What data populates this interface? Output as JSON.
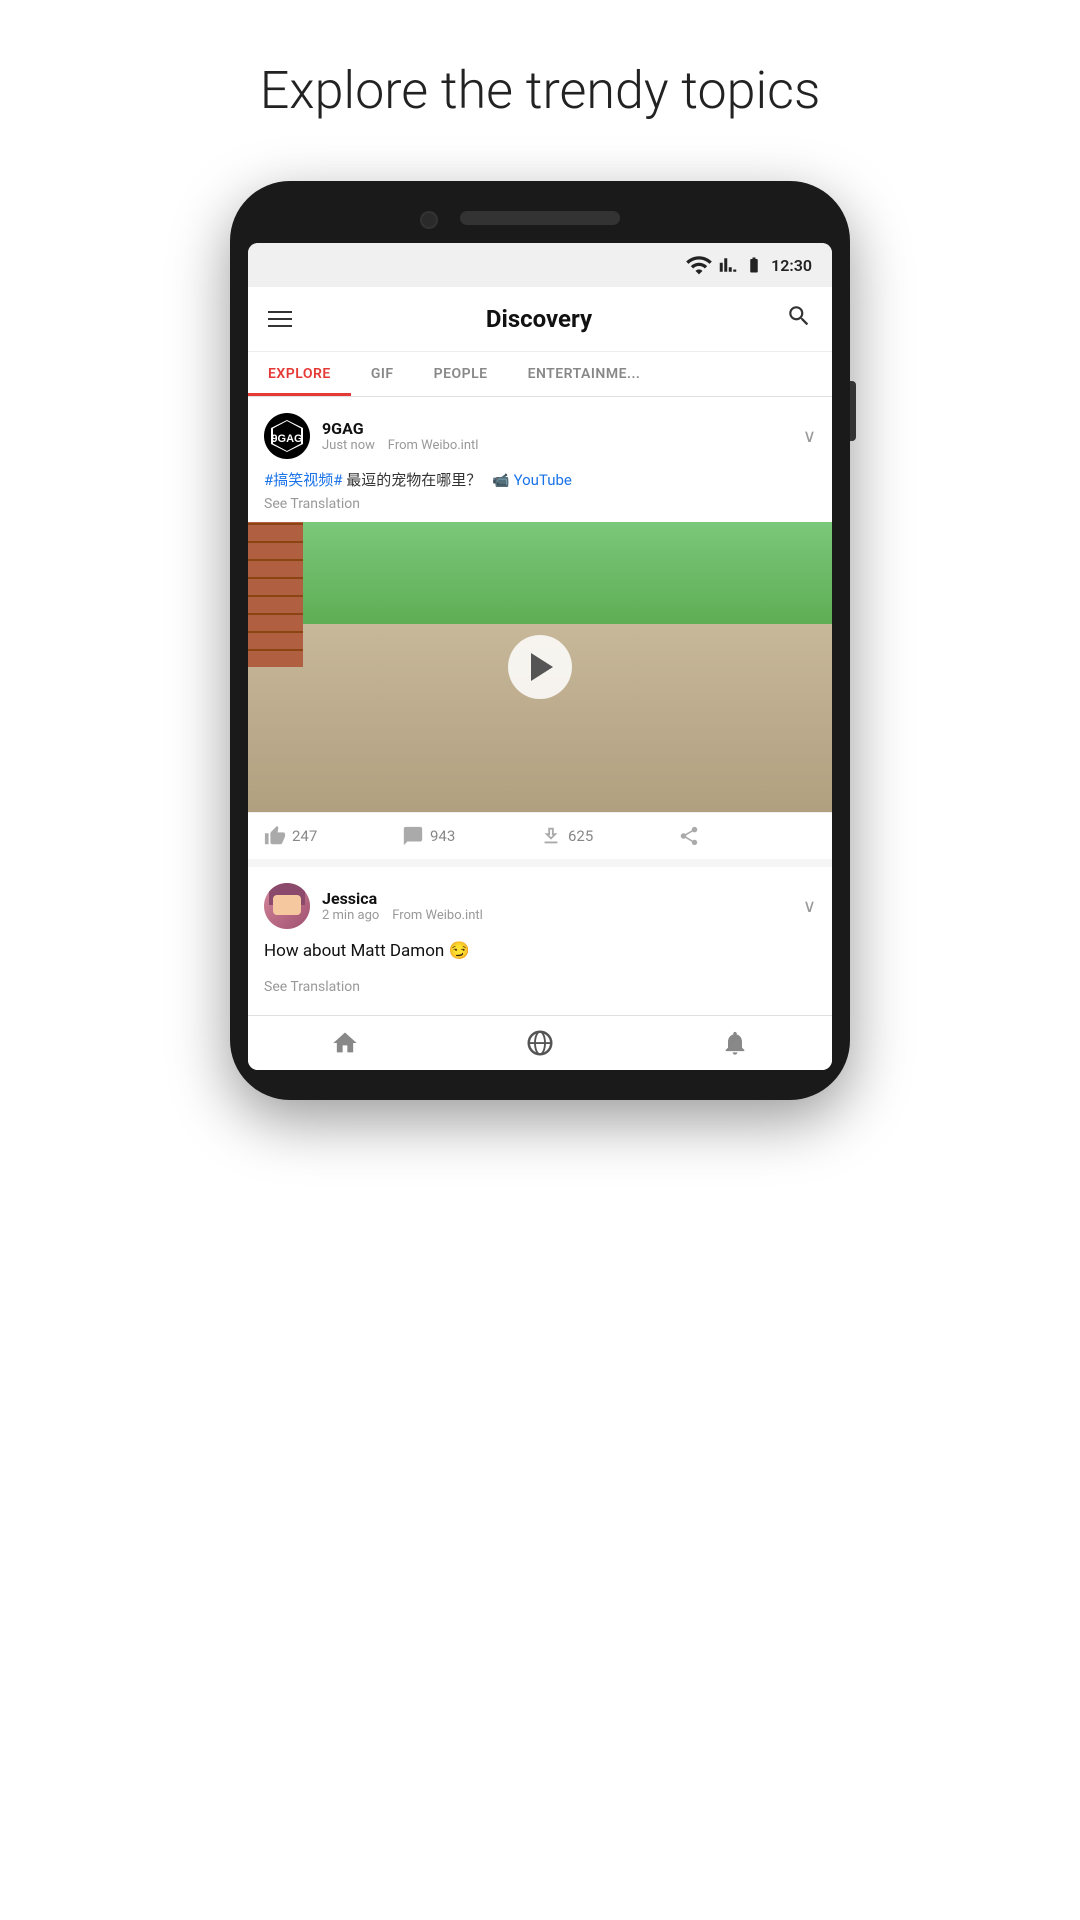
{
  "page": {
    "headline": "Explore the trendy topics"
  },
  "status_bar": {
    "time": "12:30",
    "wifi": "▼",
    "signal": "▲",
    "battery": "▮"
  },
  "header": {
    "title": "Discovery",
    "menu_label": "menu",
    "search_label": "search"
  },
  "tabs": [
    {
      "id": "explore",
      "label": "EXPLORE",
      "active": true
    },
    {
      "id": "gif",
      "label": "GIF",
      "active": false
    },
    {
      "id": "people",
      "label": "PEOPLE",
      "active": false
    },
    {
      "id": "entertainment",
      "label": "ENTERTAINME...",
      "active": false
    }
  ],
  "posts": [
    {
      "id": "post1",
      "author": "9GAG",
      "timestamp": "Just now",
      "source": "From Weibo.intl",
      "hashtags": "#搞笑视频#",
      "text_cn": " 最逗的宠物在哪里？",
      "youtube_label": "YouTube",
      "see_translation": "See Translation",
      "likes": "247",
      "comments": "943",
      "reposts": "625"
    },
    {
      "id": "post2",
      "author": "Jessica",
      "timestamp": "2 min ago",
      "source": "From Weibo.intl",
      "text": "How about Matt Damon 😏",
      "see_translation": "See Translation"
    }
  ],
  "bottom_nav": [
    {
      "id": "home",
      "label": "home",
      "active": false
    },
    {
      "id": "discover",
      "label": "discover",
      "active": true
    },
    {
      "id": "bell",
      "label": "notifications",
      "active": false
    }
  ],
  "colors": {
    "active_tab": "#e53935",
    "hashtag": "#1a73e8",
    "youtube": "#1a73e8",
    "primary_text": "#111111",
    "secondary_text": "#999999"
  }
}
